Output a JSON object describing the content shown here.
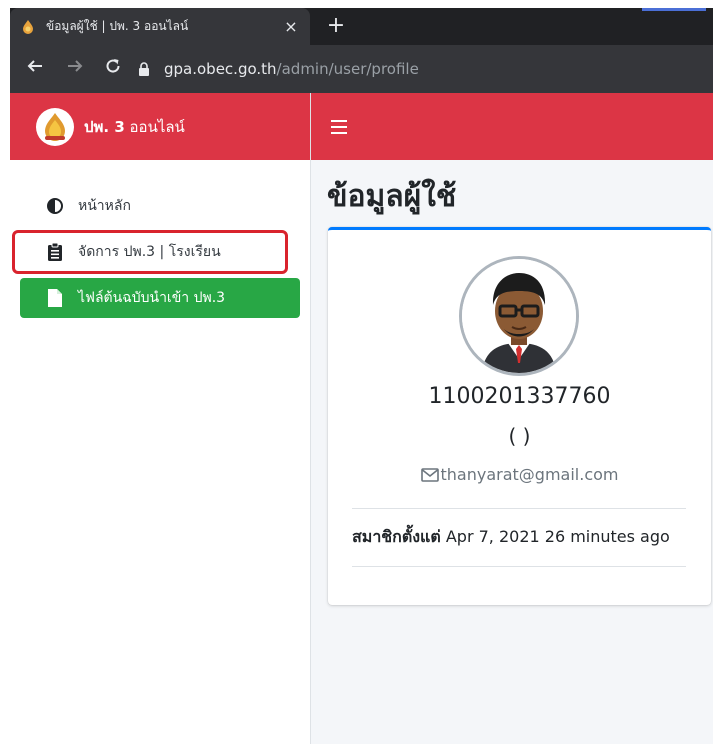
{
  "browser": {
    "tab_title": "ข้อมูลผู้ใช้ | ปพ. 3 ออนไลน์",
    "close_glyph": "×",
    "newtab_glyph": "+",
    "url_host": "gpa.obec.go.th",
    "url_path": "/admin/user/profile"
  },
  "sidebar": {
    "brand_bold": "ปพ. 3",
    "brand_rest": " ออนไลน์",
    "items": [
      {
        "label": "หน้าหลัก",
        "icon": "half-circle-icon"
      },
      {
        "label": "จัดการ ปพ.3 | โรงเรียน",
        "icon": "clipboard-icon"
      },
      {
        "label": "ไฟล์ต้นฉบับนำเข้า ปพ.3",
        "icon": "file-icon"
      }
    ]
  },
  "main": {
    "page_title": "ข้อมูลผู้ใช้",
    "profile": {
      "username": "1100201337760",
      "subtitle": "( )",
      "email": "thanyarat@gmail.com",
      "member_since_label": "สมาชิกตั้งแต่",
      "member_since_value": " Apr 7, 2021 26 minutes ago"
    }
  },
  "colors": {
    "brand_red": "#dc3545",
    "active_green": "#28a745",
    "card_accent": "#007bff",
    "highlight_box": "#d9232d"
  }
}
